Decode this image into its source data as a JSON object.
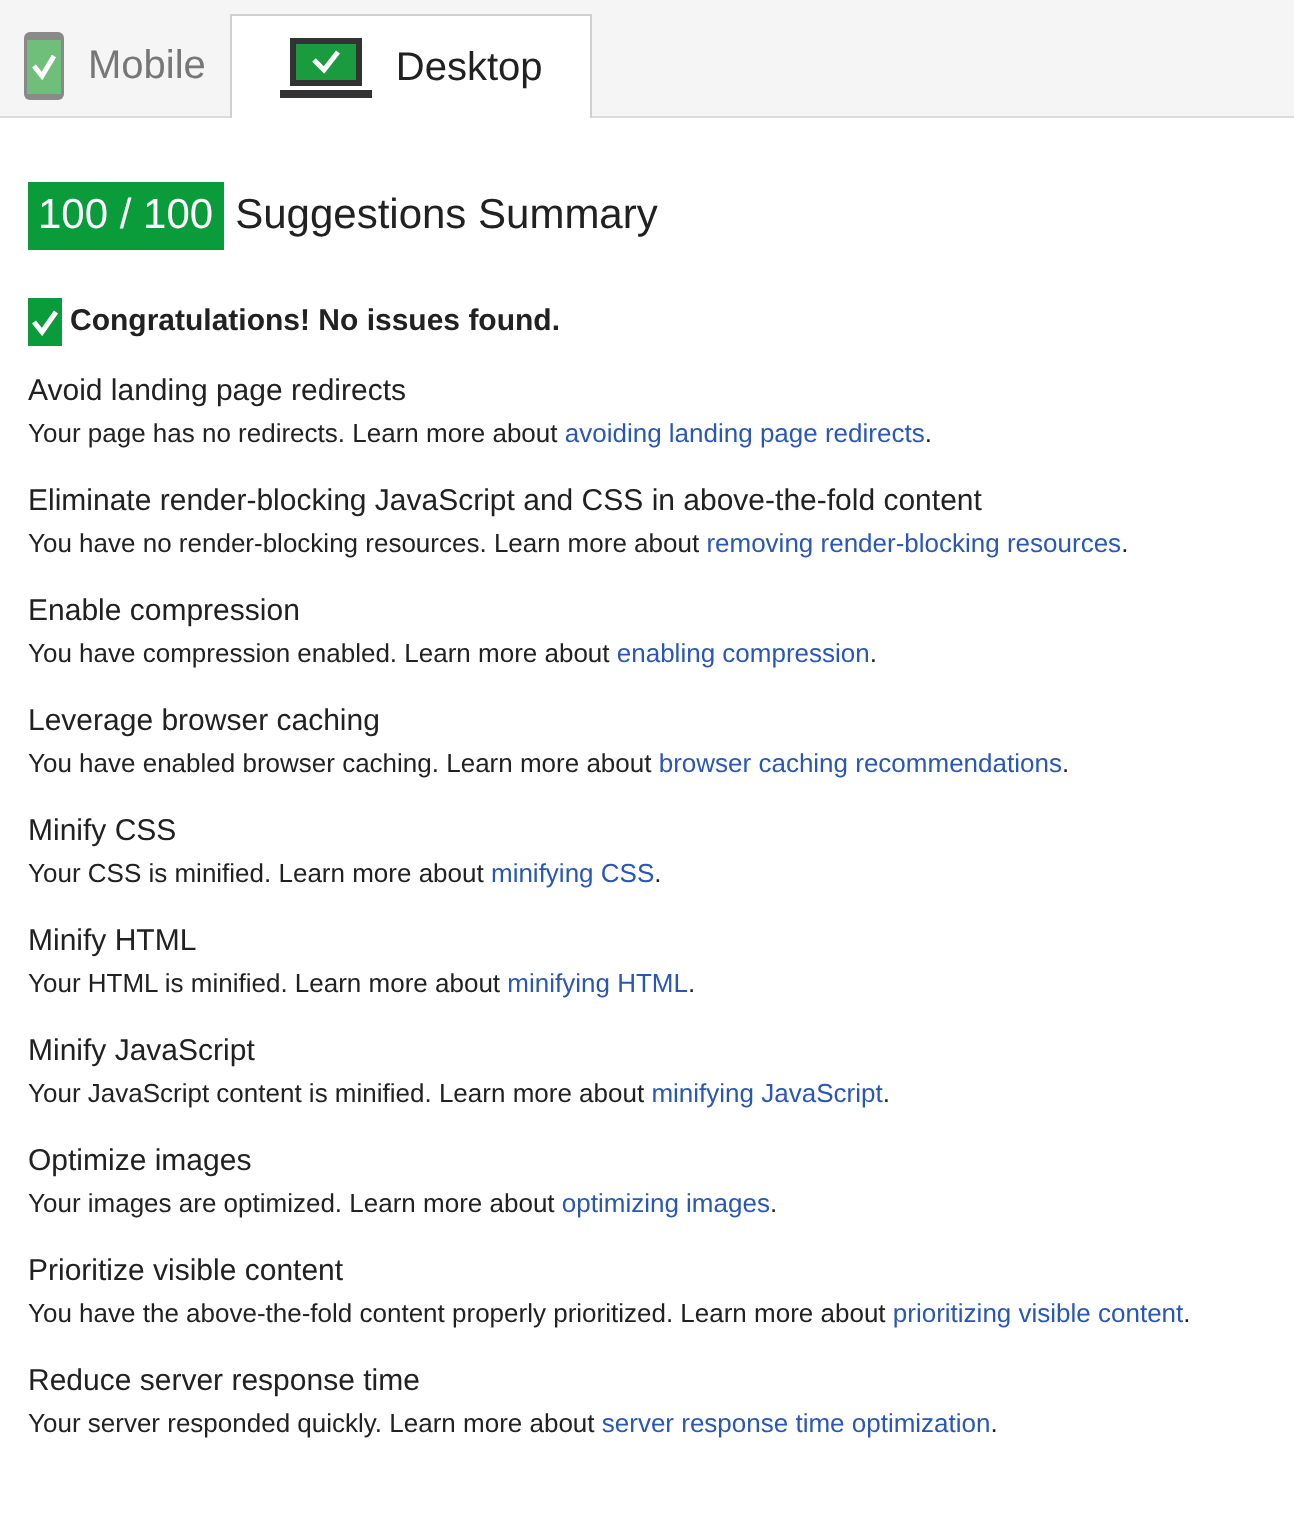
{
  "tabs": [
    {
      "label": "Mobile",
      "kind": "mobile",
      "selected": false
    },
    {
      "label": "Desktop",
      "kind": "desktop",
      "selected": true
    }
  ],
  "score": "100 / 100",
  "heading": "Suggestions Summary",
  "congrats": "Congratulations! No issues found.",
  "rules": [
    {
      "title": "Avoid landing page redirects",
      "text": "Your page has no redirects. Learn more about ",
      "link": "avoiding landing page redirects",
      "end": "."
    },
    {
      "title": "Eliminate render-blocking JavaScript and CSS in above-the-fold content",
      "text": "You have no render-blocking resources. Learn more about ",
      "link": "removing render-blocking resources",
      "end": "."
    },
    {
      "title": "Enable compression",
      "text": "You have compression enabled. Learn more about ",
      "link": "enabling compression",
      "end": "."
    },
    {
      "title": "Leverage browser caching",
      "text": "You have enabled browser caching. Learn more about ",
      "link": "browser caching recommendations",
      "end": "."
    },
    {
      "title": "Minify CSS",
      "text": "Your CSS is minified. Learn more about ",
      "link": "minifying CSS",
      "end": "."
    },
    {
      "title": "Minify HTML",
      "text": "Your HTML is minified. Learn more about ",
      "link": "minifying HTML",
      "end": "."
    },
    {
      "title": "Minify JavaScript",
      "text": "Your JavaScript content is minified. Learn more about ",
      "link": "minifying JavaScript",
      "end": "."
    },
    {
      "title": "Optimize images",
      "text": "Your images are optimized. Learn more about ",
      "link": "optimizing images",
      "end": "."
    },
    {
      "title": "Prioritize visible content",
      "text": "You have the above-the-fold content properly prioritized. Learn more about ",
      "link": "prioritizing visible content",
      "end": "."
    },
    {
      "title": "Reduce server response time",
      "text": "Your server responded quickly. Learn more about ",
      "link": "server response time optimization",
      "end": "."
    }
  ]
}
